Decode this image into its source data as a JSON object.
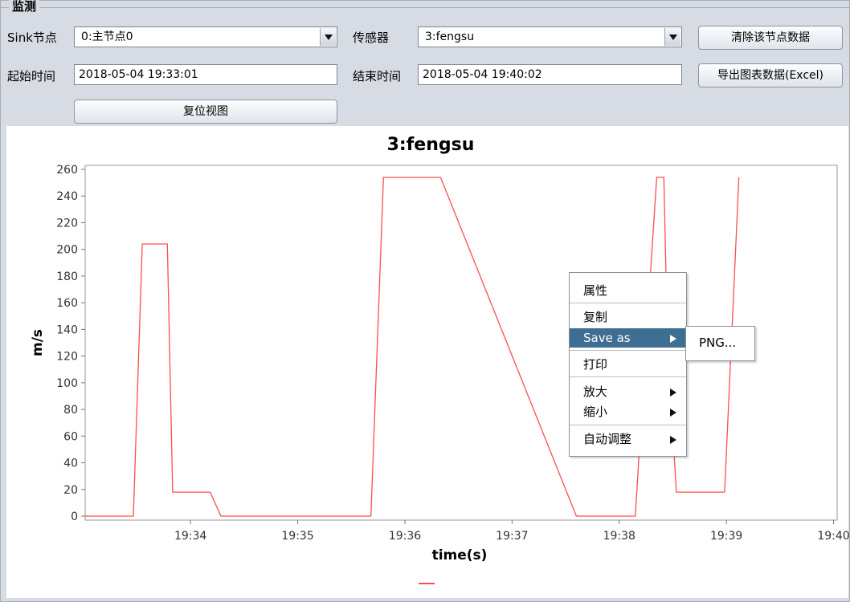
{
  "group": {
    "title": "监测"
  },
  "controls": {
    "sink_label": "Sink节点",
    "sink_value": "0:主节点0",
    "sensor_label": "传感器",
    "sensor_value": "3:fengsu",
    "clear_button": "清除该节点数据",
    "start_label": "起始时间",
    "start_value": "2018-05-04 19:33:01",
    "end_label": "结束时间",
    "end_value": "2018-05-04 19:40:02",
    "export_button": "导出图表数据(Excel)",
    "reset_button": "复位视图"
  },
  "colors": {
    "line": "#ff4d4d",
    "menu_highlight": "#3e6e91"
  },
  "chart_data": {
    "type": "line",
    "title": "3:fengsu",
    "xlabel": "time(s)",
    "ylabel": "m/s",
    "x_ticks": [
      "19:34",
      "19:35",
      "19:36",
      "19:37",
      "19:38",
      "19:39",
      "19:40"
    ],
    "y_ticks": [
      0,
      20,
      40,
      60,
      80,
      100,
      120,
      140,
      160,
      180,
      200,
      220,
      240,
      260
    ],
    "xlim": [
      "19:33:01",
      "19:40:02"
    ],
    "ylim": [
      -3,
      263
    ],
    "grid": false,
    "legend": "bottom",
    "series": [
      {
        "x": [
          "19:33:01",
          "19:33:28",
          "19:33:33",
          "19:33:47",
          "19:33:50",
          "19:34:11",
          "19:34:17",
          "19:35:41",
          "19:35:48",
          "19:36:20",
          "19:37:36",
          "19:38:09",
          "19:38:14",
          "19:38:21",
          "19:38:25",
          "19:38:27",
          "19:38:32",
          "19:38:52",
          "19:38:54",
          "19:38:59",
          "19:39:07"
        ],
        "y": [
          0,
          0,
          204,
          204,
          18,
          18,
          0,
          0,
          254,
          254,
          0,
          0,
          110,
          254,
          254,
          130,
          18,
          18,
          18,
          18,
          254
        ]
      }
    ]
  },
  "context_menu": {
    "items": [
      "属性",
      "复制",
      "Save as",
      "打印",
      "放大",
      "缩小",
      "自动调整"
    ],
    "submenu": [
      "PNG..."
    ]
  }
}
